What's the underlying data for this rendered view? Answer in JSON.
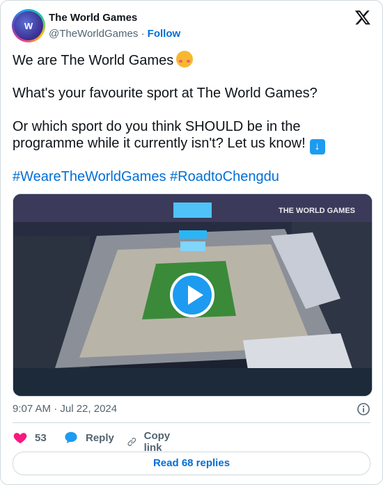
{
  "author": {
    "display_name": "The World Games",
    "handle": "@TheWorldGames",
    "separator": "·",
    "follow_label": "Follow",
    "avatar_text": "W"
  },
  "tweet": {
    "line1": "We are The World Games",
    "line2": "What's your favourite sport at The World Games?",
    "line3": "Or which sport do you think SHOULD be in the",
    "line4": "programme while it currently isn't? Let us know!",
    "hashtags": [
      "#WeareTheWorldGames",
      "#RoadtoChengdu"
    ]
  },
  "media": {
    "type": "video",
    "watermark": "THE WORLD GAMES"
  },
  "meta": {
    "timestamp": "9:07 AM · Jul 22, 2024"
  },
  "actions": {
    "like_count": "53",
    "reply_label": "Reply",
    "copy_label": "Copy link"
  },
  "footer": {
    "read_replies": "Read 68 replies"
  },
  "colors": {
    "link": "#006fd6",
    "like": "#f91880",
    "reply": "#1d9bf0",
    "muted": "#536471"
  }
}
